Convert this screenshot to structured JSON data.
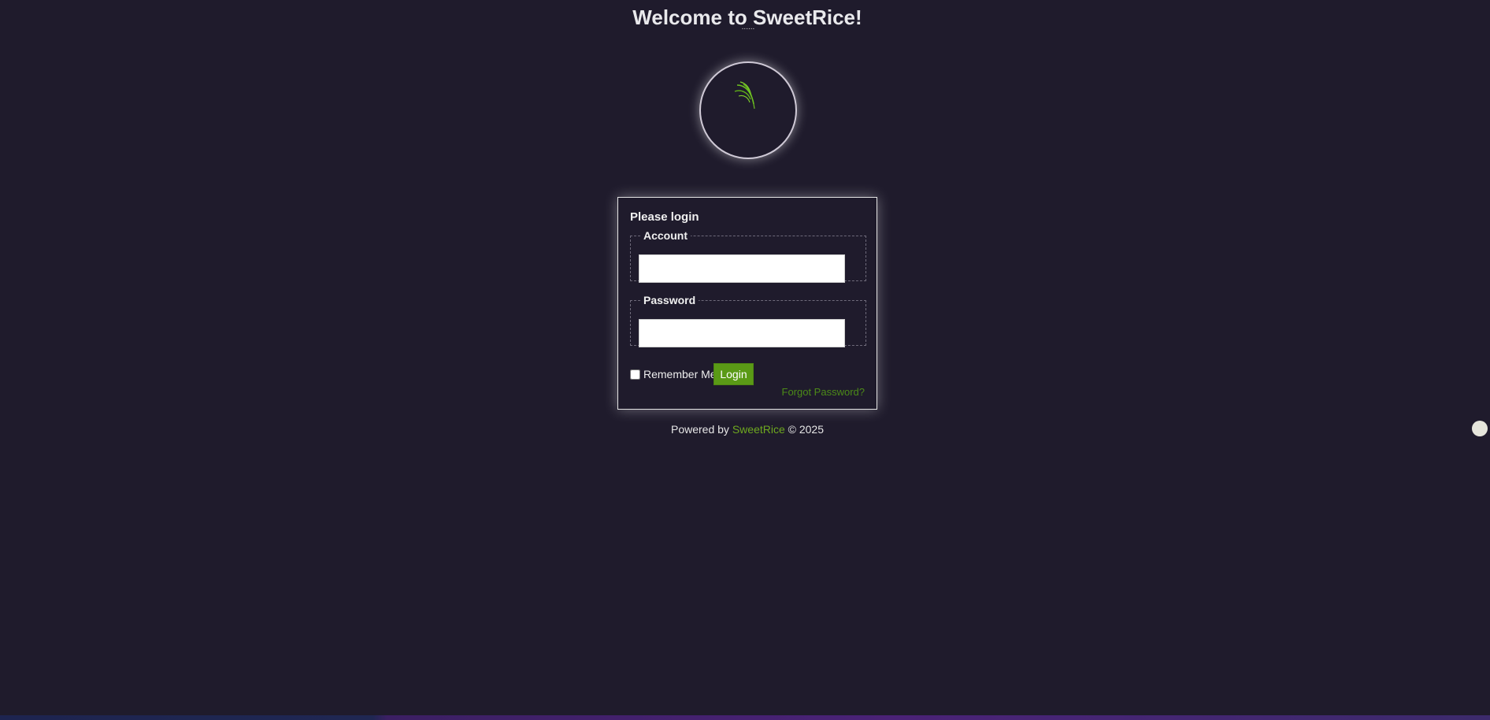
{
  "header": {
    "title": "Welcome to SweetRice!",
    "subtitle_dots": "......"
  },
  "logo": {
    "icon": "rice-leaf-icon",
    "color": "#6cc020"
  },
  "login": {
    "heading": "Please login",
    "account": {
      "legend": "Account",
      "value": "",
      "placeholder": ""
    },
    "password": {
      "legend": "Password",
      "value": "",
      "placeholder": ""
    },
    "remember_label": "Remember Me",
    "remember_checked": false,
    "login_button": "Login",
    "forgot_link": "Forgot Password?"
  },
  "footer": {
    "prefix": "Powered by",
    "brand": "SweetRice",
    "suffix": "© 2025"
  },
  "colors": {
    "background": "#1f1b2c",
    "accent": "#5a9a16",
    "link": "#6ea81f"
  }
}
